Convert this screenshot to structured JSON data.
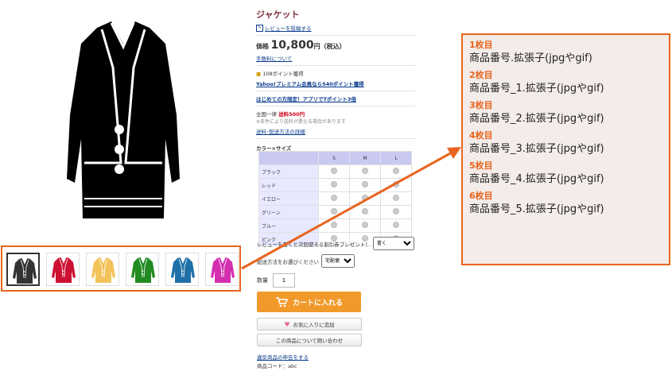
{
  "product": {
    "title": "ジャケット",
    "review_link": "レビューを投稿する",
    "price_label": "価格",
    "price_value": "10,800",
    "price_unit": "円",
    "price_tax": "（税込）",
    "fee_link": "手数料について",
    "points_text": "108ポイント獲得",
    "points_link": "Yahoo!プレミアム会員なら540ポイント獲得",
    "first_time_link": "はじめての方限定！アプリでTポイント3倍",
    "shipping_prefix": "全国一律",
    "shipping_value": "送料500円",
    "shipping_note": "※条件により送料が異なる場合があります",
    "shipping_link": "送料･配送方法の詳細"
  },
  "variation": {
    "heading": "カラー×サイズ",
    "sizes": [
      "S",
      "M",
      "L"
    ],
    "colors": [
      "ブラック",
      "レッド",
      "イエロー",
      "グリーン",
      "ブルー",
      "ピンク"
    ]
  },
  "options": {
    "review_coupon_label": "レビューを書くと次回使える割引券プレゼント！",
    "review_coupon_value": "書く",
    "delivery_label": "配送方法をお選びください",
    "delivery_value": "宅配便",
    "qty_label": "数量",
    "qty_value": "1"
  },
  "buttons": {
    "cart": "カートに入れる",
    "favorite": "お気に入りに追加",
    "inquiry": "この商品について問い合わせ"
  },
  "footer": {
    "report_link": "違反商品の申告をする",
    "code": "商品コード：abc"
  },
  "thumbnails": [
    {
      "name": "black",
      "color": "#333333"
    },
    {
      "name": "red",
      "color": "#cc1133"
    },
    {
      "name": "yellow",
      "color": "#f2c35a"
    },
    {
      "name": "green",
      "color": "#228b22"
    },
    {
      "name": "blue",
      "color": "#1f6fa8"
    },
    {
      "name": "pink",
      "color": "#d42fb0"
    }
  ],
  "annotation": [
    {
      "heading": "1枚目",
      "text": "商品番号.拡張子(jpgやgif)"
    },
    {
      "heading": "2枚目",
      "text": "商品番号_1.拡張子(jpgやgif)"
    },
    {
      "heading": "3枚目",
      "text": "商品番号_2.拡張子(jpgやgif)"
    },
    {
      "heading": "4枚目",
      "text": "商品番号_3.拡張子(jpgやgif)"
    },
    {
      "heading": "5枚目",
      "text": "商品番号_4.拡張子(jpgやgif)"
    },
    {
      "heading": "6枚目",
      "text": "商品番号_5.拡張子(jpgやgif)"
    }
  ],
  "colors": {
    "accent": "#e8641e",
    "cart": "#f19a2b",
    "title": "#7a2f3c"
  }
}
